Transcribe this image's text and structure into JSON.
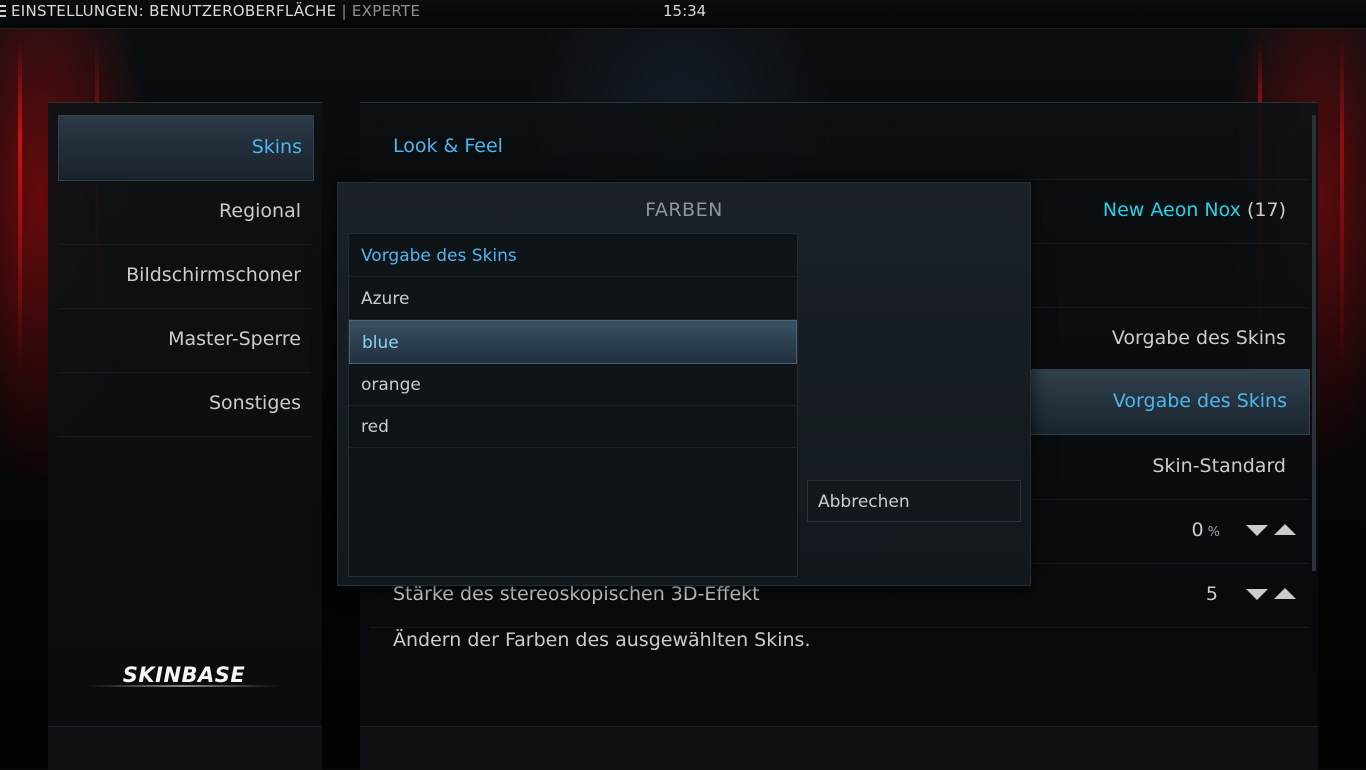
{
  "topbar": {
    "breadcrumb": "EINSTELLUNGEN: BENUTZEROBERFLÄCHE",
    "separator": "|",
    "level": "EXPERTE",
    "time": "15:34"
  },
  "sidebar": {
    "items": [
      {
        "label": "Skins",
        "active": true
      },
      {
        "label": "Regional"
      },
      {
        "label": "Bildschirmschoner"
      },
      {
        "label": "Master-Sperre"
      },
      {
        "label": "Sonstiges"
      }
    ],
    "logo_text": "SKINBASE"
  },
  "main": {
    "section_header": "Look & Feel",
    "rows": [
      {
        "value": "New Aeon Nox",
        "extra": "(17)"
      },
      {
        "value": ""
      },
      {
        "value": "Vorgabe des Skins"
      },
      {
        "value": "Vorgabe des Skins"
      },
      {
        "value": "Skin-Standard"
      },
      {
        "value": "0",
        "unit": "%"
      },
      {
        "label": "Stärke des stereoskopischen 3D-Effekt",
        "value": "5"
      }
    ],
    "description": "Ändern der Farben des ausgewählten Skins."
  },
  "dialog": {
    "title": "FARBEN",
    "options": [
      "Vorgabe des Skins",
      "Azure",
      "blue",
      "orange",
      "red"
    ],
    "selected": "blue",
    "cancel_label": "Abbrechen"
  },
  "colors": {
    "accent": "#4fb5ee",
    "teal": "#22d3e6"
  }
}
